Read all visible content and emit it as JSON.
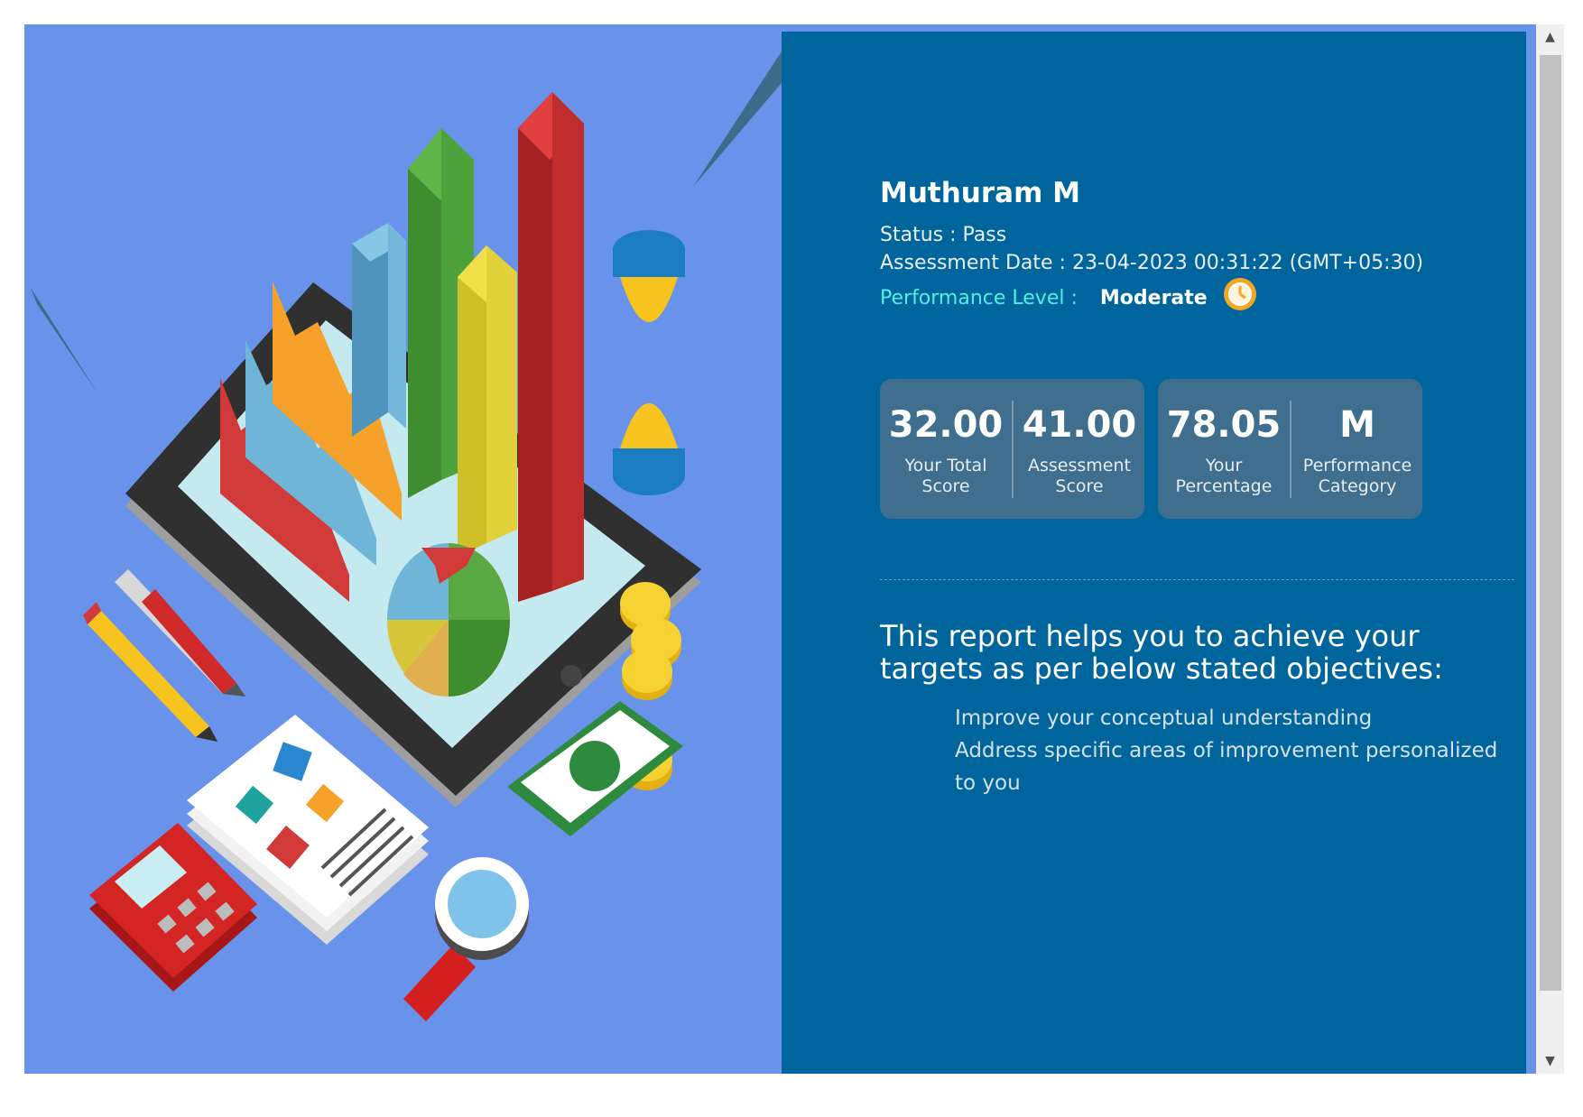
{
  "user": {
    "name": "Muthuram M"
  },
  "status": {
    "label": "Status :",
    "value": "Pass"
  },
  "assessment_date": {
    "label": "Assessment Date :",
    "value": "23-04-2023 00:31:22 (GMT+05:30)"
  },
  "performance": {
    "label": "Performance Level :",
    "value": "Moderate",
    "icon": "clock-icon",
    "icon_color": "#f5a623"
  },
  "scores": [
    {
      "value": "32.00",
      "label_line1": "Your Total",
      "label_line2": "Score"
    },
    {
      "value": "41.00",
      "label_line1": "Assessment",
      "label_line2": "Score"
    },
    {
      "value": "78.05",
      "label_line1": "Your",
      "label_line2": "Percentage"
    },
    {
      "value": "M",
      "label_line1": "Performance",
      "label_line2": "Category"
    }
  ],
  "objectives": {
    "title": "This report helps you to achieve your targets as per below stated objectives:",
    "items": [
      "Improve your conceptual understanding",
      "Address specific areas of improvement personalized to you"
    ]
  },
  "scrollbar": {
    "up_icon": "arrow-up-icon",
    "down_icon": "arrow-down-icon"
  },
  "colors": {
    "illustration_bg": "#6993ea",
    "panel_bg": "#00659c",
    "card_bg": "#3f6e8e",
    "accent_teal": "#52f0e6"
  }
}
